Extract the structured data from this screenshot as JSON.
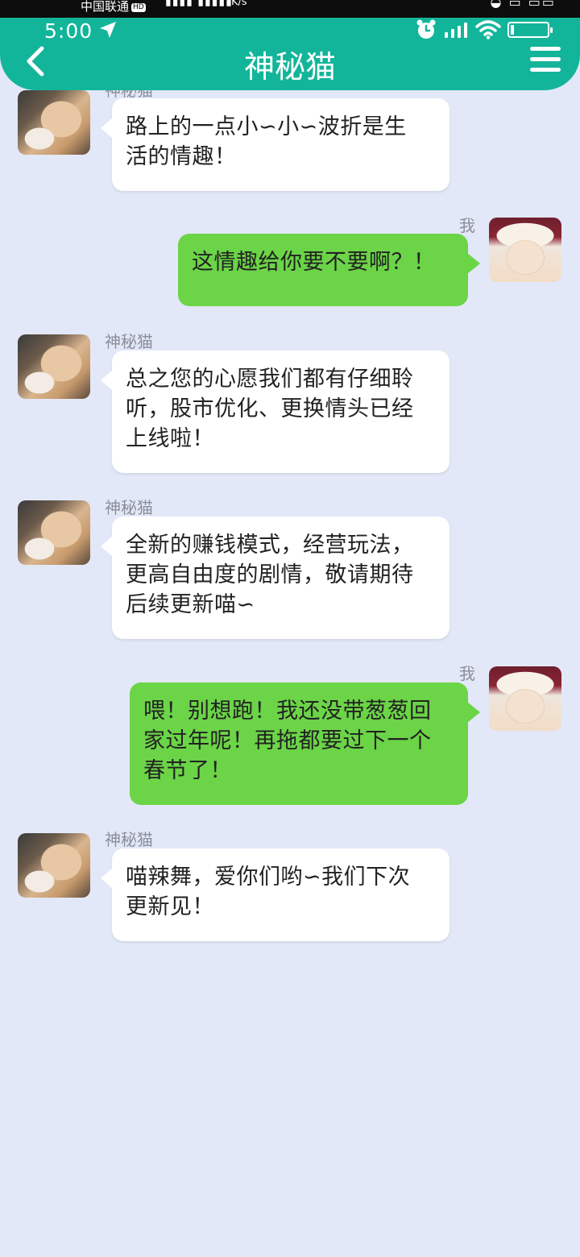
{
  "status_bar": {
    "carrier": "中国联通",
    "hd_badge": "HD",
    "speed_unit": "K/s",
    "time": "5:00"
  },
  "header": {
    "title": "神秘猫",
    "back_icon": "chevron-left-icon",
    "menu_icon": "hamburger-menu-icon"
  },
  "messages": [
    {
      "side": "left",
      "sender": "神秘猫",
      "avatar": "sleepy-cat-avatar",
      "lines": [
        "路上的一点小∽小∽波折是生",
        "活的情趣！"
      ]
    },
    {
      "side": "right",
      "sender": "我",
      "avatar": "santa-cat-avatar",
      "lines": [
        "这情趣给你要不要啊？！"
      ]
    },
    {
      "side": "left",
      "sender": "神秘猫",
      "avatar": "sleepy-cat-avatar",
      "lines": [
        "总之您的心愿我们都有仔细聆",
        "听，股市优化、更换情头已经",
        "上线啦！"
      ]
    },
    {
      "side": "left",
      "sender": "神秘猫",
      "avatar": "sleepy-cat-avatar",
      "lines": [
        "全新的赚钱模式，经营玩法，",
        "更高自由度的剧情，敬请期待",
        "后续更新喵∽"
      ]
    },
    {
      "side": "right",
      "sender": "我",
      "avatar": "santa-cat-avatar",
      "lines": [
        "喂！别想跑！我还没带葱葱回",
        "家过年呢！再拖都要过下一个",
        "春节了！"
      ]
    },
    {
      "side": "left",
      "sender": "神秘猫",
      "avatar": "sleepy-cat-avatar",
      "lines": [
        "喵辣舞，爱你们哟∽我们下次",
        "更新见！"
      ]
    }
  ],
  "colors": {
    "header_bg": "#13b59a",
    "chat_bg": "#e2e8f8",
    "incoming_bubble": "#ffffff",
    "outgoing_bubble": "#6bd447"
  }
}
